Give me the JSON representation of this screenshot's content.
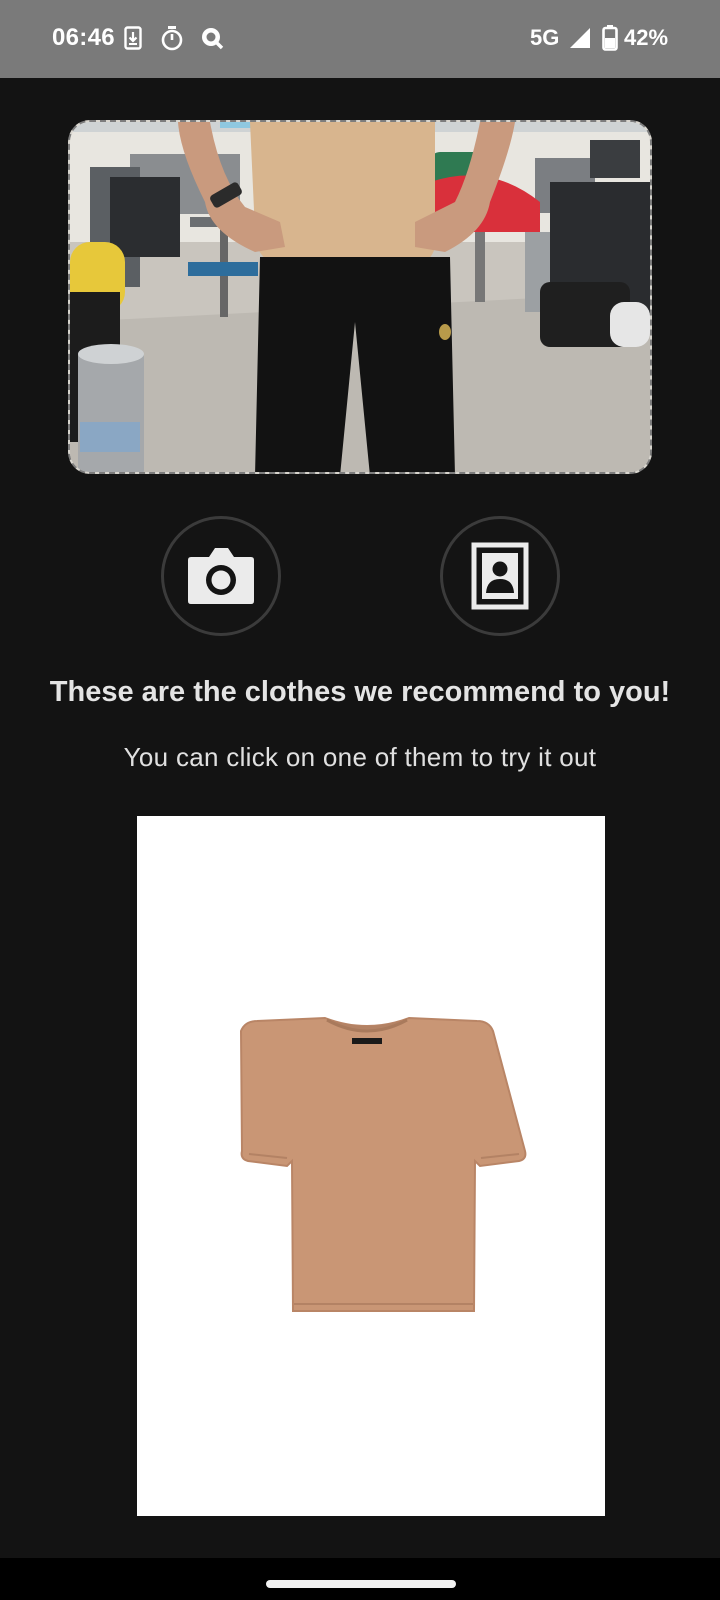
{
  "status_bar": {
    "time": "06:46",
    "network": "5G",
    "battery": "42%",
    "icons": [
      "download-notification-icon",
      "timer-icon",
      "search-notification-icon",
      "signal-icon",
      "battery-icon"
    ]
  },
  "user_photo": {
    "icon": "user-photo-preview"
  },
  "actions": {
    "camera_icon": "camera-icon",
    "gallery_icon": "gallery-portrait-icon"
  },
  "recommendations": {
    "title": "These are the clothes we recommend to you!",
    "subtitle": "You can click on one of them to try it out",
    "items": [
      {
        "type": "t-shirt",
        "color": "#c99675"
      }
    ]
  },
  "colors": {
    "background": "#131313",
    "status_bar": "#7a7a7a",
    "card": "#ffffff",
    "text": "#e4e4e4"
  }
}
